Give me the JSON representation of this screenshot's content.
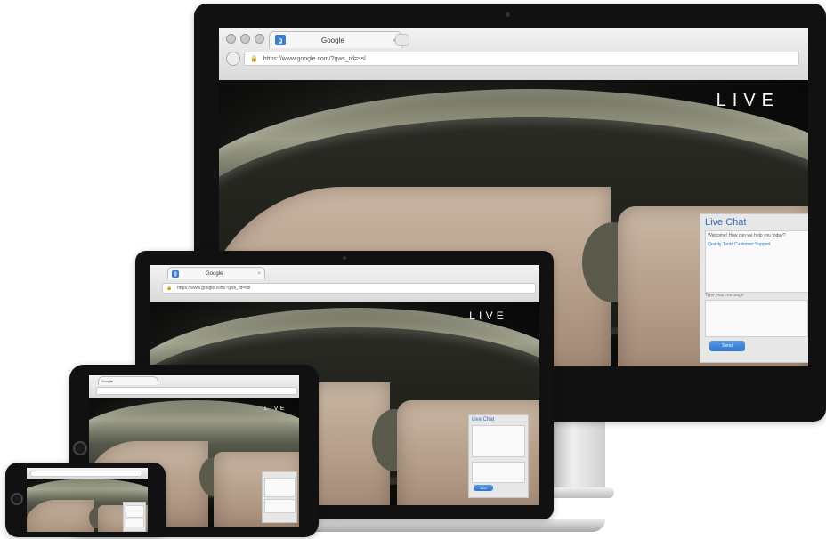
{
  "browser": {
    "tab_title": "Google",
    "tab_icon_letter": "g",
    "tab_close": "×",
    "url": "https://www.google.com/?gws_rd=ssl"
  },
  "live_label": "LIVE",
  "chat": {
    "title": "Live Chat",
    "message_lines": [
      "Welcome! How can we help you today?",
      "Quality Toolz Customer Support"
    ],
    "input_label": "Type your message",
    "send_label": "Send"
  },
  "colors": {
    "chat_title": "#2f6fbf",
    "send_button": "#3a7bd5",
    "lock": "#3a9a3a"
  },
  "icons": [
    "monitor-camera-icon",
    "lock-icon",
    "google-favicon-icon",
    "tablet-home-button-icon",
    "phone-home-button-icon"
  ]
}
